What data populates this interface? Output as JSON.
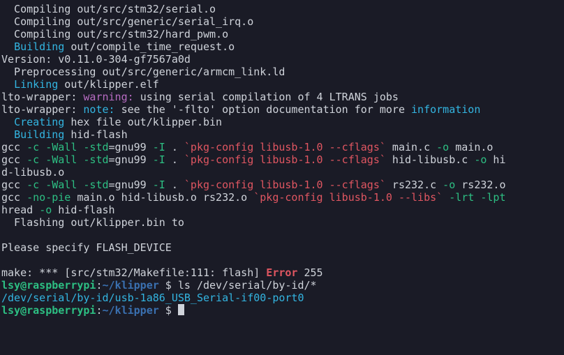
{
  "lines": [
    [
      {
        "t": "  Compiling out/src/stm32/serial.o",
        "c": "fg-default"
      }
    ],
    [
      {
        "t": "  Compiling out/src/generic/serial_irq.o",
        "c": "fg-default"
      }
    ],
    [
      {
        "t": "  Compiling out/src/stm32/hard_pwm.o",
        "c": "fg-default"
      }
    ],
    [
      {
        "t": "  ",
        "c": "fg-default"
      },
      {
        "t": "Building",
        "c": "fg-cyan"
      },
      {
        "t": " out/compile_time_request.o",
        "c": "fg-default"
      }
    ],
    [
      {
        "t": "Version: v0.11.0-304-gf7567a0d",
        "c": "fg-default"
      }
    ],
    [
      {
        "t": "  Preprocessing out/src/generic/armcm_link.ld",
        "c": "fg-default"
      }
    ],
    [
      {
        "t": "  ",
        "c": "fg-default"
      },
      {
        "t": "Linking",
        "c": "fg-cyan"
      },
      {
        "t": " out/klipper.elf",
        "c": "fg-default"
      }
    ],
    [
      {
        "t": "lto-wrapper: ",
        "c": "fg-default"
      },
      {
        "t": "warning: ",
        "c": "fg-magenta"
      },
      {
        "t": "using serial compilation of 4 LTRANS jobs",
        "c": "fg-default"
      }
    ],
    [
      {
        "t": "lto-wrapper: ",
        "c": "fg-default"
      },
      {
        "t": "note: ",
        "c": "fg-cyan"
      },
      {
        "t": "see the '",
        "c": "fg-default"
      },
      {
        "t": "-flto",
        "c": "fg-default"
      },
      {
        "t": "' option documentation for more ",
        "c": "fg-default"
      },
      {
        "t": "information",
        "c": "fg-cyan"
      }
    ],
    [
      {
        "t": "  ",
        "c": "fg-default"
      },
      {
        "t": "Creating",
        "c": "fg-cyan"
      },
      {
        "t": " hex file out/klipper.bin",
        "c": "fg-default"
      }
    ],
    [
      {
        "t": "  ",
        "c": "fg-default"
      },
      {
        "t": "Building",
        "c": "fg-cyan"
      },
      {
        "t": " hid-flash",
        "c": "fg-default"
      }
    ],
    [
      {
        "t": "gcc ",
        "c": "fg-default"
      },
      {
        "t": "-c",
        "c": "fg-green"
      },
      {
        "t": " ",
        "c": "fg-default"
      },
      {
        "t": "-Wall",
        "c": "fg-green"
      },
      {
        "t": " ",
        "c": "fg-default"
      },
      {
        "t": "-std",
        "c": "fg-green"
      },
      {
        "t": "=gnu99 ",
        "c": "fg-default"
      },
      {
        "t": "-I",
        "c": "fg-green"
      },
      {
        "t": " . ",
        "c": "fg-default"
      },
      {
        "t": "`pkg-config libusb-1.0 --cflags`",
        "c": "fg-red"
      },
      {
        "t": " main.c ",
        "c": "fg-default"
      },
      {
        "t": "-o",
        "c": "fg-green"
      },
      {
        "t": " main.o",
        "c": "fg-default"
      }
    ],
    [
      {
        "t": "gcc ",
        "c": "fg-default"
      },
      {
        "t": "-c",
        "c": "fg-green"
      },
      {
        "t": " ",
        "c": "fg-default"
      },
      {
        "t": "-Wall",
        "c": "fg-green"
      },
      {
        "t": " ",
        "c": "fg-default"
      },
      {
        "t": "-std",
        "c": "fg-green"
      },
      {
        "t": "=gnu99 ",
        "c": "fg-default"
      },
      {
        "t": "-I",
        "c": "fg-green"
      },
      {
        "t": " . ",
        "c": "fg-default"
      },
      {
        "t": "`pkg-config libusb-1.0 --cflags`",
        "c": "fg-red"
      },
      {
        "t": " hid-libusb.c ",
        "c": "fg-default"
      },
      {
        "t": "-o",
        "c": "fg-green"
      },
      {
        "t": " hi",
        "c": "fg-default"
      }
    ],
    [
      {
        "t": "d-libusb.o",
        "c": "fg-default"
      }
    ],
    [
      {
        "t": "gcc ",
        "c": "fg-default"
      },
      {
        "t": "-c",
        "c": "fg-green"
      },
      {
        "t": " ",
        "c": "fg-default"
      },
      {
        "t": "-Wall",
        "c": "fg-green"
      },
      {
        "t": " ",
        "c": "fg-default"
      },
      {
        "t": "-std",
        "c": "fg-green"
      },
      {
        "t": "=gnu99 ",
        "c": "fg-default"
      },
      {
        "t": "-I",
        "c": "fg-green"
      },
      {
        "t": " . ",
        "c": "fg-default"
      },
      {
        "t": "`pkg-config libusb-1.0 --cflags`",
        "c": "fg-red"
      },
      {
        "t": " rs232.c ",
        "c": "fg-default"
      },
      {
        "t": "-o",
        "c": "fg-green"
      },
      {
        "t": " rs232.o",
        "c": "fg-default"
      }
    ],
    [
      {
        "t": "gcc ",
        "c": "fg-default"
      },
      {
        "t": "-no-pie",
        "c": "fg-green"
      },
      {
        "t": " main.o hid-libusb.o rs232.o ",
        "c": "fg-default"
      },
      {
        "t": "`pkg-config libusb-1.0 --libs`",
        "c": "fg-red"
      },
      {
        "t": " ",
        "c": "fg-default"
      },
      {
        "t": "-lrt",
        "c": "fg-green"
      },
      {
        "t": " ",
        "c": "fg-default"
      },
      {
        "t": "-lpt",
        "c": "fg-green"
      }
    ],
    [
      {
        "t": "hread ",
        "c": "fg-default"
      },
      {
        "t": "-o",
        "c": "fg-green"
      },
      {
        "t": " hid-flash",
        "c": "fg-default"
      }
    ],
    [
      {
        "t": "  Flashing out/klipper.bin to",
        "c": "fg-default"
      }
    ],
    [
      {
        "t": " ",
        "c": "fg-default"
      }
    ],
    [
      {
        "t": "Please specify FLASH_DEVICE",
        "c": "fg-default"
      }
    ],
    [
      {
        "t": " ",
        "c": "fg-default"
      }
    ],
    [
      {
        "t": "make: *** [src/stm32/Makefile:111: flash] ",
        "c": "fg-default"
      },
      {
        "t": "Error",
        "c": "fg-redb"
      },
      {
        "t": " 255",
        "c": "fg-default"
      }
    ],
    [
      {
        "t": "lsy@raspberrypi",
        "c": "fg-greenb"
      },
      {
        "t": ":",
        "c": "fg-default"
      },
      {
        "t": "~/klipper",
        "c": "fg-blueb"
      },
      {
        "t": " $ ",
        "c": "fg-default"
      },
      {
        "t": "ls /dev/serial/by-id/*",
        "c": "fg-default"
      }
    ],
    [
      {
        "t": "/dev/serial/by-id/usb-1a86_USB_Serial-if00-port0",
        "c": "fg-cyan"
      }
    ],
    [
      {
        "t": "lsy@raspberrypi",
        "c": "fg-greenb"
      },
      {
        "t": ":",
        "c": "fg-default"
      },
      {
        "t": "~/klipper",
        "c": "fg-blueb"
      },
      {
        "t": " $ ",
        "c": "fg-default"
      },
      {
        "t": "",
        "c": "cursor"
      }
    ]
  ]
}
